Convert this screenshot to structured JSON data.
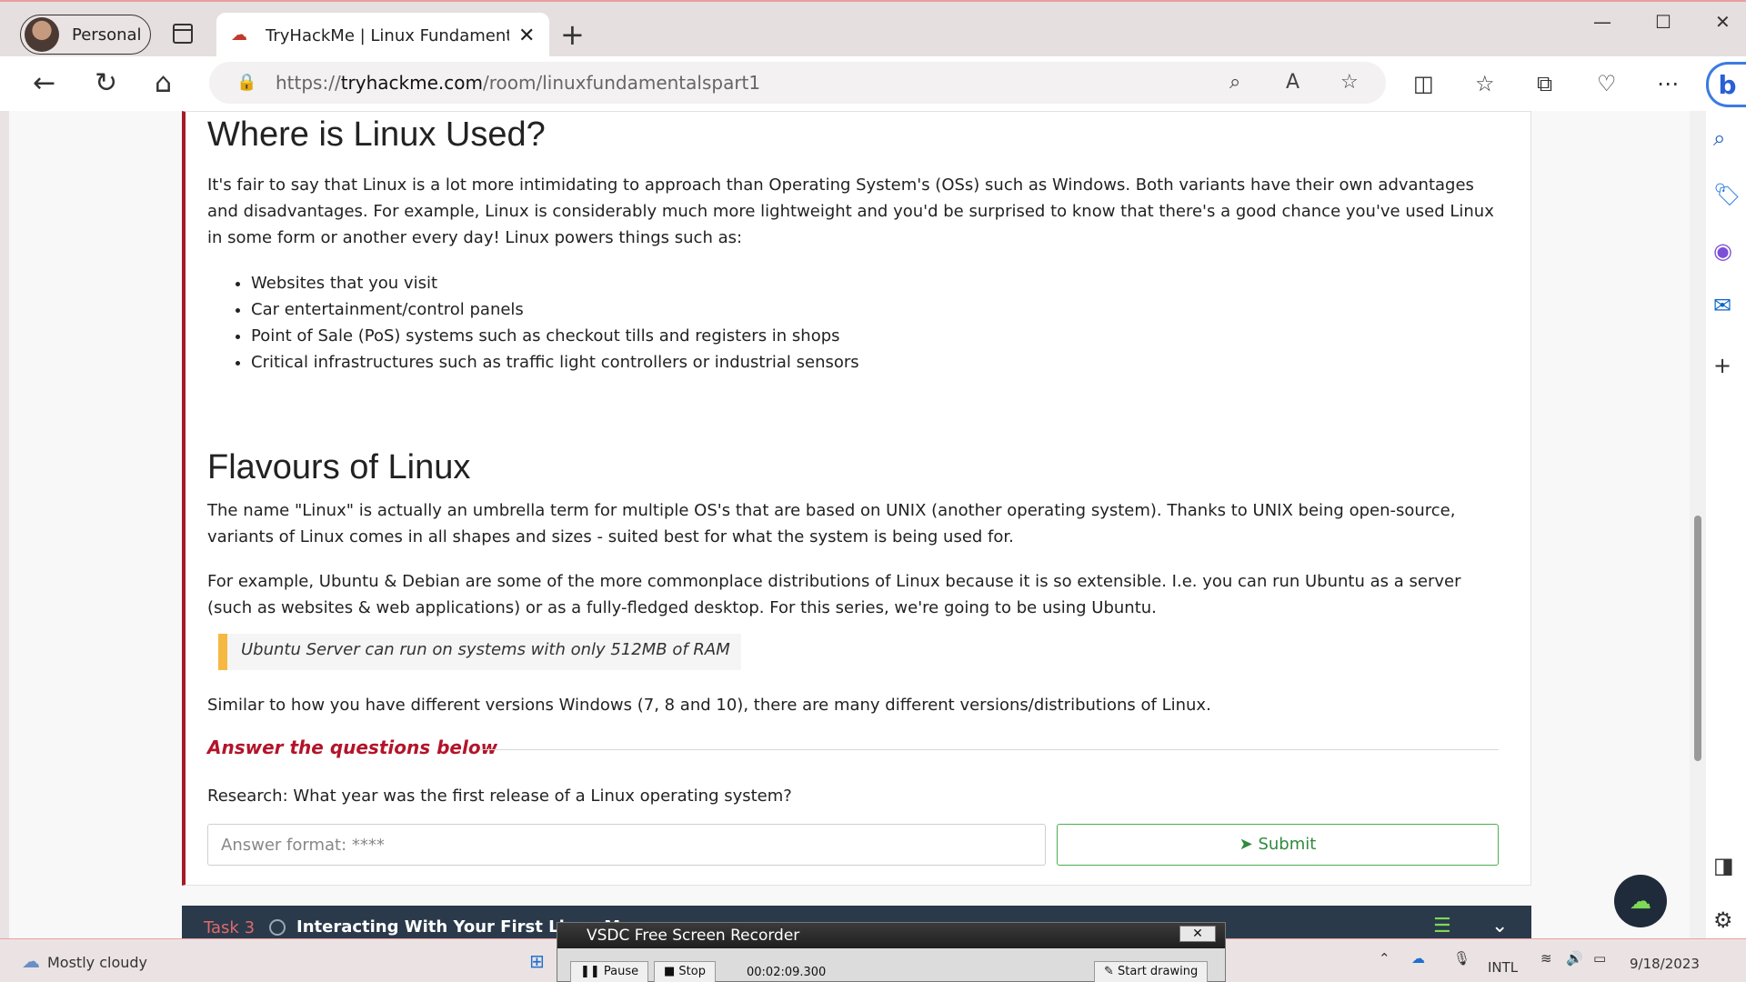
{
  "browser": {
    "profile_label": "Personal",
    "tab_title": "TryHackMe | Linux Fundamentals",
    "url_prefix": "https://",
    "url_domain": "tryhackme.com",
    "url_path": "/room/linuxfundamentalspart1"
  },
  "content": {
    "heading_used": "Where is Linux Used?",
    "para_used": "It's fair to say that Linux is a lot more intimidating to approach than Operating System's (OSs) such as Windows. Both variants have their own advantages and disadvantages. For example, Linux is considerably much more lightweight and you'd be surprised to know that there's a good chance you've used Linux in some form or another every day! Linux powers things such as:",
    "list": [
      "Websites that you visit",
      "Car entertainment/control panels",
      "Point of Sale (PoS) systems such as checkout tills and registers in shops",
      "Critical infrastructures such as traffic light controllers or industrial sensors"
    ],
    "heading_flavours": "Flavours of Linux",
    "para_flavours_1": "The name \"Linux\" is actually an umbrella term for multiple OS's that are based on UNIX (another operating system). Thanks to UNIX being open-source, variants of Linux comes in all shapes and sizes - suited best for what the system is being used for.",
    "para_flavours_2": "For example, Ubuntu & Debian are some of the more commonplace distributions of Linux because it is so extensible. I.e. you can run Ubuntu as a server (such as websites & web applications) or as a fully-fledged desktop. For this series, we're going to be using Ubuntu.",
    "quote": "Ubuntu Server can run on systems with only 512MB of RAM",
    "para_flavours_3": "Similar to how you have different versions Windows (7, 8 and 10), there are many different versions/distributions of Linux.",
    "answer_title": "Answer the questions below",
    "question": "Research: What year was the first release of a Linux operating system?",
    "answer_placeholder": "Answer format: ****",
    "submit_label": "Submit"
  },
  "next_task": {
    "number": "Task 3",
    "name": "Interacting With Your First Linux M"
  },
  "system": {
    "weather": "Mostly cloudy",
    "keyboard": "INTL",
    "date": "9/18/2023"
  },
  "recorder": {
    "title": "VSDC Free Screen Recorder",
    "pause": "Pause",
    "stop": "Stop",
    "time": "00:02:09.300",
    "draw": "Start drawing"
  },
  "colors": {
    "accent_red": "#a31c24",
    "submit_green": "#4caf50",
    "quote_bar": "#f5b942",
    "task_bar": "#2b3a4b"
  }
}
